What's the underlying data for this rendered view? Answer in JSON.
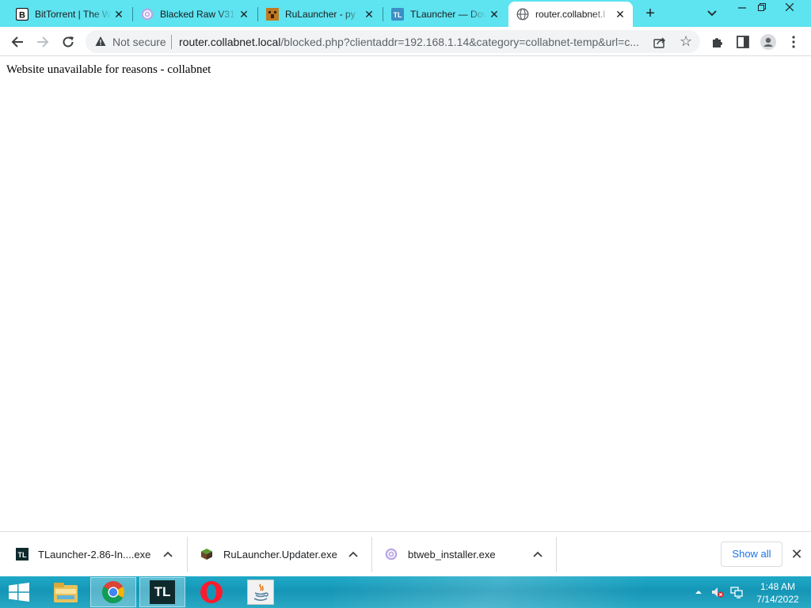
{
  "tabs": [
    {
      "title": "BitTorrent | The W",
      "icon": "bittorrent-icon"
    },
    {
      "title": "Blacked Raw V31",
      "icon": "bittorrent-web-icon"
    },
    {
      "title": "RuLauncher - py",
      "icon": "rulauncher-icon"
    },
    {
      "title": "TLauncher — Dov",
      "icon": "tlauncher-icon"
    },
    {
      "title": "router.collabnet.l",
      "icon": "globe-icon",
      "active": true
    }
  ],
  "toolbar": {
    "security_label": "Not secure",
    "url_host": "router.collabnet.local",
    "url_rest": "/blocked.php?clientaddr=192.168.1.14&category=collabnet-temp&url=c..."
  },
  "page": {
    "message": "Website unavailable for reasons - collabnet"
  },
  "downloads": [
    {
      "name": "TLauncher-2.86-In....exe",
      "icon": "tlauncher-icon"
    },
    {
      "name": "RuLauncher.Updater.exe",
      "icon": "minecraft-block-icon"
    },
    {
      "name": "btweb_installer.exe",
      "icon": "bittorrent-web-icon"
    }
  ],
  "shelf": {
    "show_all_label": "Show all"
  },
  "taskbar": {
    "apps": [
      "file-explorer-icon",
      "chrome-icon",
      "tlauncher-icon",
      "opera-icon",
      "java-icon"
    ],
    "tl_label": "TL",
    "time": "1:48 AM",
    "date": "7/14/2022"
  },
  "colors": {
    "tabstrip": "#5ee3f0",
    "accent": "#1a73e8",
    "taskbar": "#1596b6"
  }
}
